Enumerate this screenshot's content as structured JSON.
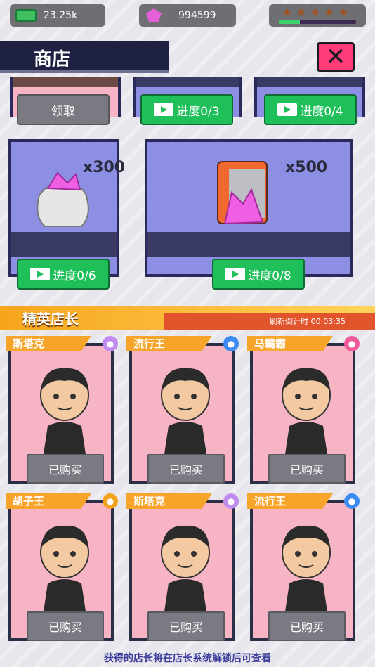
{
  "top": {
    "cash": "23.25k",
    "gems": "994599",
    "stars": 5,
    "level_progress": 0.27
  },
  "header": {
    "title": "商店"
  },
  "top_cards": [
    {
      "button": "领取"
    },
    {
      "button": "进度0/3"
    },
    {
      "button": "进度0/4"
    }
  ],
  "offers": [
    {
      "qty": "x300",
      "button": "进度0/6",
      "icon": "gem-bag-icon"
    },
    {
      "qty": "x500",
      "button": "进度0/8",
      "icon": "gem-safe-icon"
    }
  ],
  "section": {
    "title": "精英店长",
    "refresh": "刷新倒计时 00:03:35"
  },
  "managers": [
    {
      "name": "斯塔克",
      "badge_icon": "bag-icon",
      "badge_color": "#c28bf0",
      "button": "已购买"
    },
    {
      "name": "流行王",
      "badge_icon": "controller-icon",
      "badge_color": "#3d8bf0",
      "button": "已购买"
    },
    {
      "name": "马霸霸",
      "badge_icon": "shirt-icon",
      "badge_color": "#f05a9a",
      "button": "已购买"
    },
    {
      "name": "胡子王",
      "badge_icon": "key-icon",
      "badge_color": "#f4a21c",
      "button": "已购买"
    },
    {
      "name": "斯塔克",
      "badge_icon": "bag-icon",
      "badge_color": "#c28bf0",
      "button": "已购买"
    },
    {
      "name": "流行王",
      "badge_icon": "controller-icon",
      "badge_color": "#3d8bf0",
      "button": "已购买"
    }
  ],
  "footer": "获得的店长将在店长系统解锁后可查看"
}
